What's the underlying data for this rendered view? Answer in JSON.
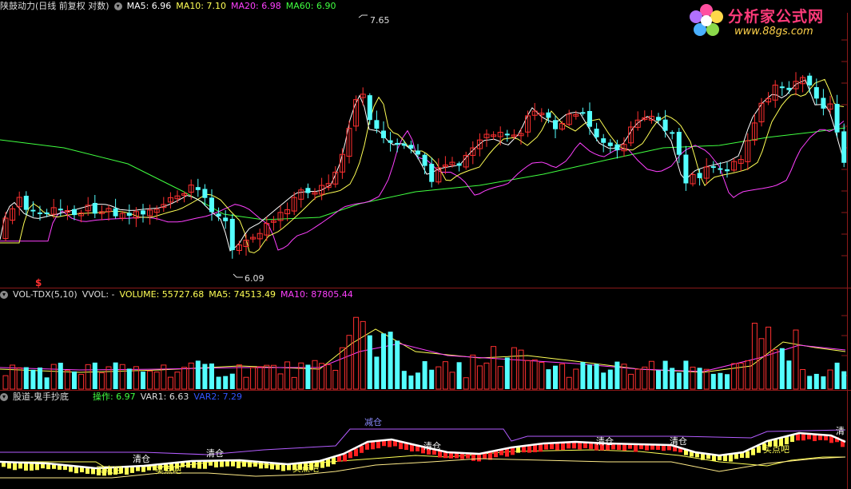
{
  "main_panel": {
    "title": "陕鼓动力(日线 前复权 对数)",
    "ma5": "MA5: 6.96",
    "ma10": "MA10: 7.10",
    "ma20": "MA20: 6.98",
    "ma60": "MA60: 6.90",
    "high_label": "7.65",
    "low_label": "6.09",
    "marker": "$",
    "colors": {
      "up": "#ff3030",
      "down": "#54ffff",
      "ma5": "#ffffff",
      "ma10": "#ffff55",
      "ma20": "#ff40ff",
      "ma60": "#40ff40"
    }
  },
  "volume_panel": {
    "title": "VOL-TDX(5,10)",
    "vvol": "VVOL: -",
    "volume": "VOLUME: 55727.68",
    "ma5": "MA5: 74513.49",
    "ma10": "MA10: 87805.44"
  },
  "indicator_panel": {
    "title": "股道-鬼手抄底",
    "op": "操作: 6.97",
    "var1": "VAR1: 6.63",
    "var2": "VAR2: 7.29",
    "labels": {
      "reduce": "减仓",
      "clear1": "清仓",
      "clear2": "清仓",
      "clear3": "清仓",
      "clear4": "清仓",
      "clear5": "清仓",
      "clear_cut": "清",
      "buy1": "买点吧",
      "buy2": "买点吧",
      "buy3": "买点吧",
      "buy4": "买点吧"
    }
  },
  "watermark": {
    "brand": "分析家公式网",
    "url": "www.88gs.com"
  },
  "icons": [
    "collapse-circle-icon",
    "flower-logo-icon"
  ]
}
